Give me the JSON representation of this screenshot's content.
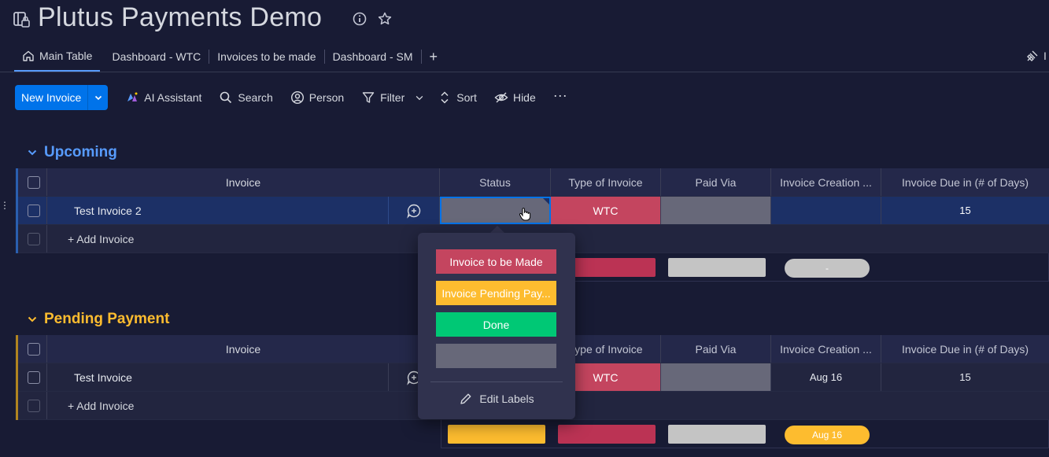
{
  "board": {
    "title": "Plutus Payments Demo"
  },
  "tabs": [
    {
      "label": "Main Table"
    },
    {
      "label": "Dashboard - WTC"
    },
    {
      "label": "Invoices to be made"
    },
    {
      "label": "Dashboard - SM"
    }
  ],
  "tabs_add": "+",
  "tabs_right_label": "I",
  "toolbar": {
    "new_label": "New Invoice",
    "ai": "AI Assistant",
    "search": "Search",
    "person": "Person",
    "filter": "Filter",
    "sort": "Sort",
    "hide": "Hide",
    "more": "···"
  },
  "columns": {
    "invoice": "Invoice",
    "status": "Status",
    "type": "Type of Invoice",
    "paid": "Paid Via",
    "creation": "Invoice Creation ...",
    "due": "Invoice Due in (# of Days)"
  },
  "groups": {
    "upcoming": {
      "title": "Upcoming",
      "color": "#579bfc",
      "row": {
        "name": "Test Invoice 2",
        "type": "WTC",
        "due": "15"
      },
      "add": "+ Add Invoice",
      "summary_creation": "-"
    },
    "pending": {
      "title": "Pending Payment",
      "color": "#fdbc2f",
      "row": {
        "name": "Test Invoice",
        "type": "WTC",
        "creation": "Aug 16",
        "due": "15"
      },
      "add": "+ Add Invoice",
      "summary_creation": "Aug 16"
    }
  },
  "status_popup": {
    "options": [
      {
        "label": "Invoice to be Made",
        "color": "#c4455f"
      },
      {
        "label": "Invoice Pending Pay...",
        "color": "#fdbc2f"
      },
      {
        "label": "Done",
        "color": "#00c875"
      },
      {
        "label": "",
        "color": "#676879"
      }
    ],
    "edit_label": "Edit Labels"
  },
  "colors": {
    "background": "#181b34",
    "accent": "#0073ea",
    "wtc": "#c4455f",
    "selected_row": "#1c3066"
  }
}
